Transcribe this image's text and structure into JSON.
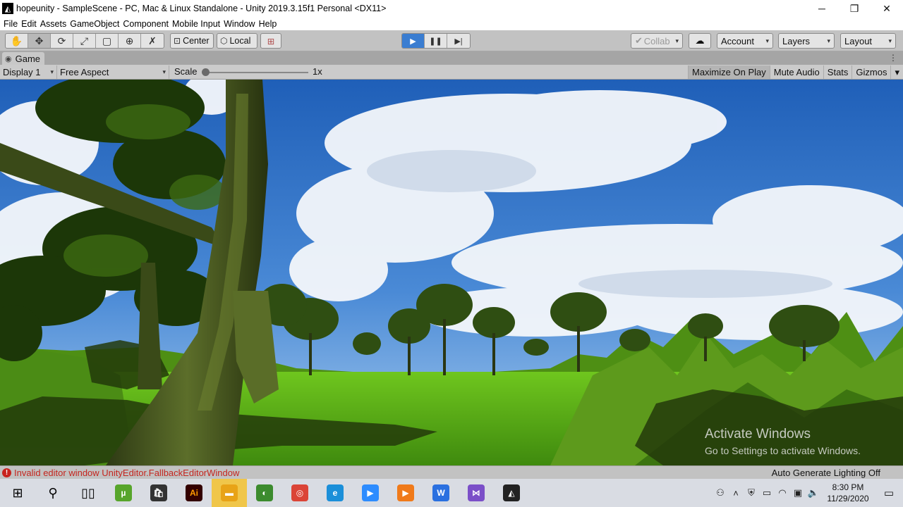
{
  "window": {
    "title": "hopeunity - SampleScene - PC, Mac & Linux Standalone - Unity 2019.3.15f1 Personal <DX11>",
    "app_icon": "unity-icon",
    "minimize": "─",
    "restore": "❐",
    "close": "✕"
  },
  "menu": [
    "File",
    "Edit",
    "Assets",
    "GameObject",
    "Component",
    "Mobile Input",
    "Window",
    "Help"
  ],
  "toolbar": {
    "tools": [
      {
        "name": "hand-tool-icon",
        "glyph": "✋"
      },
      {
        "name": "move-tool-icon",
        "glyph": "✥"
      },
      {
        "name": "rotate-tool-icon",
        "glyph": "⟳"
      },
      {
        "name": "scale-tool-icon",
        "glyph": "⤢"
      },
      {
        "name": "rect-tool-icon",
        "glyph": "▢"
      },
      {
        "name": "transform-tool-icon",
        "glyph": "⊕"
      },
      {
        "name": "custom-tool-icon",
        "glyph": "✗"
      }
    ],
    "pivot_label": "Center",
    "space_label": "Local",
    "snap_glyph": "⊞",
    "play_glyph": "▶",
    "pause_glyph": "❚❚",
    "step_glyph": "▶|",
    "collab_label": "Collab",
    "collab_glyph": "✔",
    "cloud_glyph": "☁",
    "account_label": "Account",
    "layers_label": "Layers",
    "layout_label": "Layout",
    "caret": "▾"
  },
  "game_tab": {
    "label": "Game",
    "icon_glyph": "◉",
    "menu_glyph": "⋮"
  },
  "game_view": {
    "display": "Display 1",
    "aspect": "Free Aspect",
    "scale_label": "Scale",
    "scale_value": "1x",
    "scale_fraction": 0,
    "maximize_on_play": "Maximize On Play",
    "mute_audio": "Mute Audio",
    "stats": "Stats",
    "gizmos": "Gizmos"
  },
  "watermark": {
    "title": "Activate Windows",
    "subtitle": "Go to Settings to activate Windows."
  },
  "status": {
    "error_glyph": "!",
    "error": "Invalid editor window UnityEditor.FallbackEditorWindow",
    "lighting": "Auto Generate Lighting Off"
  },
  "taskbar": {
    "apps": [
      {
        "name": "start-button-icon",
        "glyph": "⊞",
        "color": "#000000",
        "bg": ""
      },
      {
        "name": "search-icon",
        "glyph": "⚲",
        "color": "#000000",
        "bg": ""
      },
      {
        "name": "task-view-icon",
        "glyph": "▯▯",
        "color": "#000000",
        "bg": ""
      },
      {
        "name": "utorrent-icon",
        "glyph": "µ",
        "color": "#ffffff",
        "bg": "#57a52b"
      },
      {
        "name": "store-icon",
        "glyph": "🛍",
        "color": "#ffffff",
        "bg": "#333333"
      },
      {
        "name": "illustrator-icon",
        "glyph": "Ai",
        "color": "#ff9a00",
        "bg": "#330000"
      },
      {
        "name": "file-explorer-icon",
        "glyph": "▬",
        "color": "#ffffff",
        "bg": "#e8a317"
      },
      {
        "name": "greenshot-icon",
        "glyph": "◐",
        "color": "#ffffff",
        "bg": "#3c8b2e"
      },
      {
        "name": "chrome-icon",
        "glyph": "◎",
        "color": "#ffffff",
        "bg": "#db4437"
      },
      {
        "name": "edge-icon",
        "glyph": "e",
        "color": "#ffffff",
        "bg": "#1b8fd9"
      },
      {
        "name": "zoom-icon",
        "glyph": "▶",
        "color": "#ffffff",
        "bg": "#2d8cff"
      },
      {
        "name": "media-player-icon",
        "glyph": "▶",
        "color": "#ffffff",
        "bg": "#f07a1a"
      },
      {
        "name": "wps-writer-icon",
        "glyph": "W",
        "color": "#ffffff",
        "bg": "#2a70e0"
      },
      {
        "name": "visual-studio-icon",
        "glyph": "⋈",
        "color": "#ffffff",
        "bg": "#7b4fc8"
      },
      {
        "name": "unity-taskbar-icon",
        "glyph": "◭",
        "color": "#ffffff",
        "bg": "#222222"
      }
    ],
    "tray": [
      {
        "name": "people-icon",
        "glyph": "⚇"
      },
      {
        "name": "chevron-up-icon",
        "glyph": "˄"
      },
      {
        "name": "security-icon",
        "glyph": "⛨"
      },
      {
        "name": "battery-icon",
        "glyph": "▭"
      },
      {
        "name": "wifi-icon",
        "glyph": "◠"
      },
      {
        "name": "monitor-icon",
        "glyph": "▣"
      },
      {
        "name": "volume-icon",
        "glyph": "🔈"
      }
    ],
    "time": "8:30 PM",
    "date": "11/29/2020",
    "notification_glyph": "▭"
  }
}
